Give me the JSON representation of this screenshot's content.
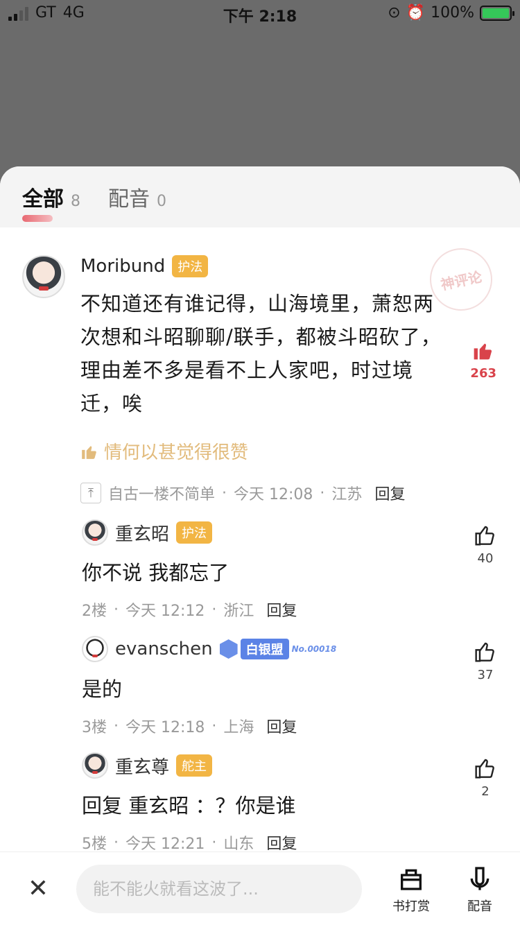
{
  "status": {
    "carrier": "GT",
    "network": "4G",
    "time": "下午 2:18",
    "battery": "100%"
  },
  "tabs": [
    {
      "label": "全部",
      "count": "8"
    },
    {
      "label": "配音",
      "count": "0"
    }
  ],
  "watermark": "神评论",
  "main_comment": {
    "user": "Moribund",
    "badge": "护法",
    "text": "不知道还有谁记得，山海境里，萧恕两次想和斗昭聊聊/联手，都被斗昭砍了，理由差不多是看不上人家吧，时过境迁，唉",
    "likes": "263",
    "praise": "情何以甚觉得很赞",
    "author": "自古一楼不简单",
    "date": "今天 12:08",
    "location": "江苏",
    "reply": "回复"
  },
  "replies": [
    {
      "user": "重玄昭",
      "badge": "护法",
      "text": "你不说  我都忘了",
      "floor": "2楼",
      "date": "今天 12:12",
      "location": "浙江",
      "reply": "回复",
      "likes": "40"
    },
    {
      "user": "evanschen",
      "badge": "白银盟",
      "badge_no": "No.00018",
      "text": "是的",
      "floor": "3楼",
      "date": "今天 12:18",
      "location": "上海",
      "reply": "回复",
      "likes": "37"
    },
    {
      "user": "重玄尊",
      "badge": "舵主",
      "text_prefix": "回复",
      "mention": "重玄昭",
      "text_suffix": "：？你是谁",
      "floor": "5楼",
      "date": "今天 12:21",
      "location": "山东",
      "reply": "回复",
      "likes": "2"
    }
  ],
  "bottom": {
    "placeholder": "能不能火就看这波了...",
    "reward_label": "书打赏",
    "dub_label": "配音"
  }
}
